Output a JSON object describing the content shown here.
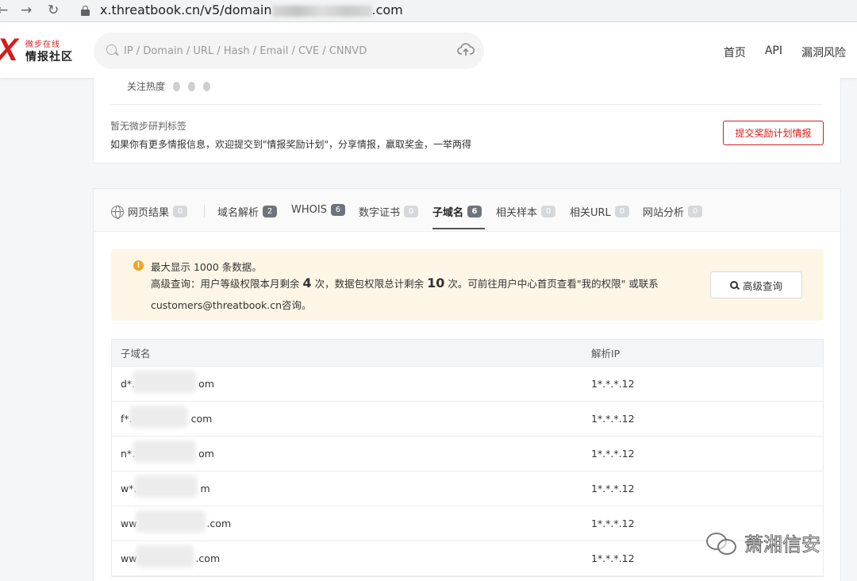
{
  "browser": {
    "url_prefix": "x.threatbook.cn/v5/domain",
    "url_suffix": ".com"
  },
  "header": {
    "logo_small": "微步在线",
    "logo_big": "情报社区",
    "search_placeholder": "IP / Domain / URL / Hash / Email / CVE / CNNVD",
    "nav": [
      "首页",
      "API",
      "漏洞风险"
    ]
  },
  "top_card": {
    "heat_label": "关注热度",
    "no_tag_text": "暂无微步研判标签",
    "tip_text": "如果你有更多情报信息，欢迎提交到\"情报奖励计划\"，分享情报，赢取奖金，一举两得",
    "submit_button": "提交奖励计划情报"
  },
  "tabs": [
    {
      "label": "网页结果",
      "count": "0"
    },
    {
      "label": "域名解析",
      "count": "2"
    },
    {
      "label": "WHOIS",
      "count": "6"
    },
    {
      "label": "数字证书",
      "count": "0"
    },
    {
      "label": "子域名",
      "count": "6",
      "active": true
    },
    {
      "label": "相关样本",
      "count": "0"
    },
    {
      "label": "相关URL",
      "count": "0"
    },
    {
      "label": "网站分析",
      "count": "0"
    }
  ],
  "notice": {
    "line1": "最大显示 1000 条数据。",
    "line2_a": "高级查询：用户等级权限本月剩余 ",
    "line2_num1": "4",
    "line2_b": " 次，数据包权限总计剩余 ",
    "line2_num2": "10",
    "line2_c": " 次。可前往用户中心首页查看\"我的权限\" 或联系",
    "line3": "customers@threatbook.cn咨询。",
    "adv_button": "高级查询"
  },
  "table": {
    "headers": [
      "子域名",
      "解析IP"
    ],
    "rows": [
      {
        "subdomain_start": "d*.",
        "subdomain_end": "om",
        "ip": "1*.*.*.12"
      },
      {
        "subdomain_start": "f*.",
        "subdomain_end": "com",
        "ip": "1*.*.*.12"
      },
      {
        "subdomain_start": "n*.",
        "subdomain_end": "om",
        "ip": "1*.*.*.12"
      },
      {
        "subdomain_start": "w*.",
        "subdomain_end": "m",
        "ip": "1*.*.*.12"
      },
      {
        "subdomain_start": "ww",
        "subdomain_end": ".com",
        "ip": "1*.*.*.12"
      },
      {
        "subdomain_start": "ww",
        "subdomain_end": ".com",
        "ip": "1*.*.*.12"
      }
    ]
  },
  "watermark": "萧湘信安"
}
